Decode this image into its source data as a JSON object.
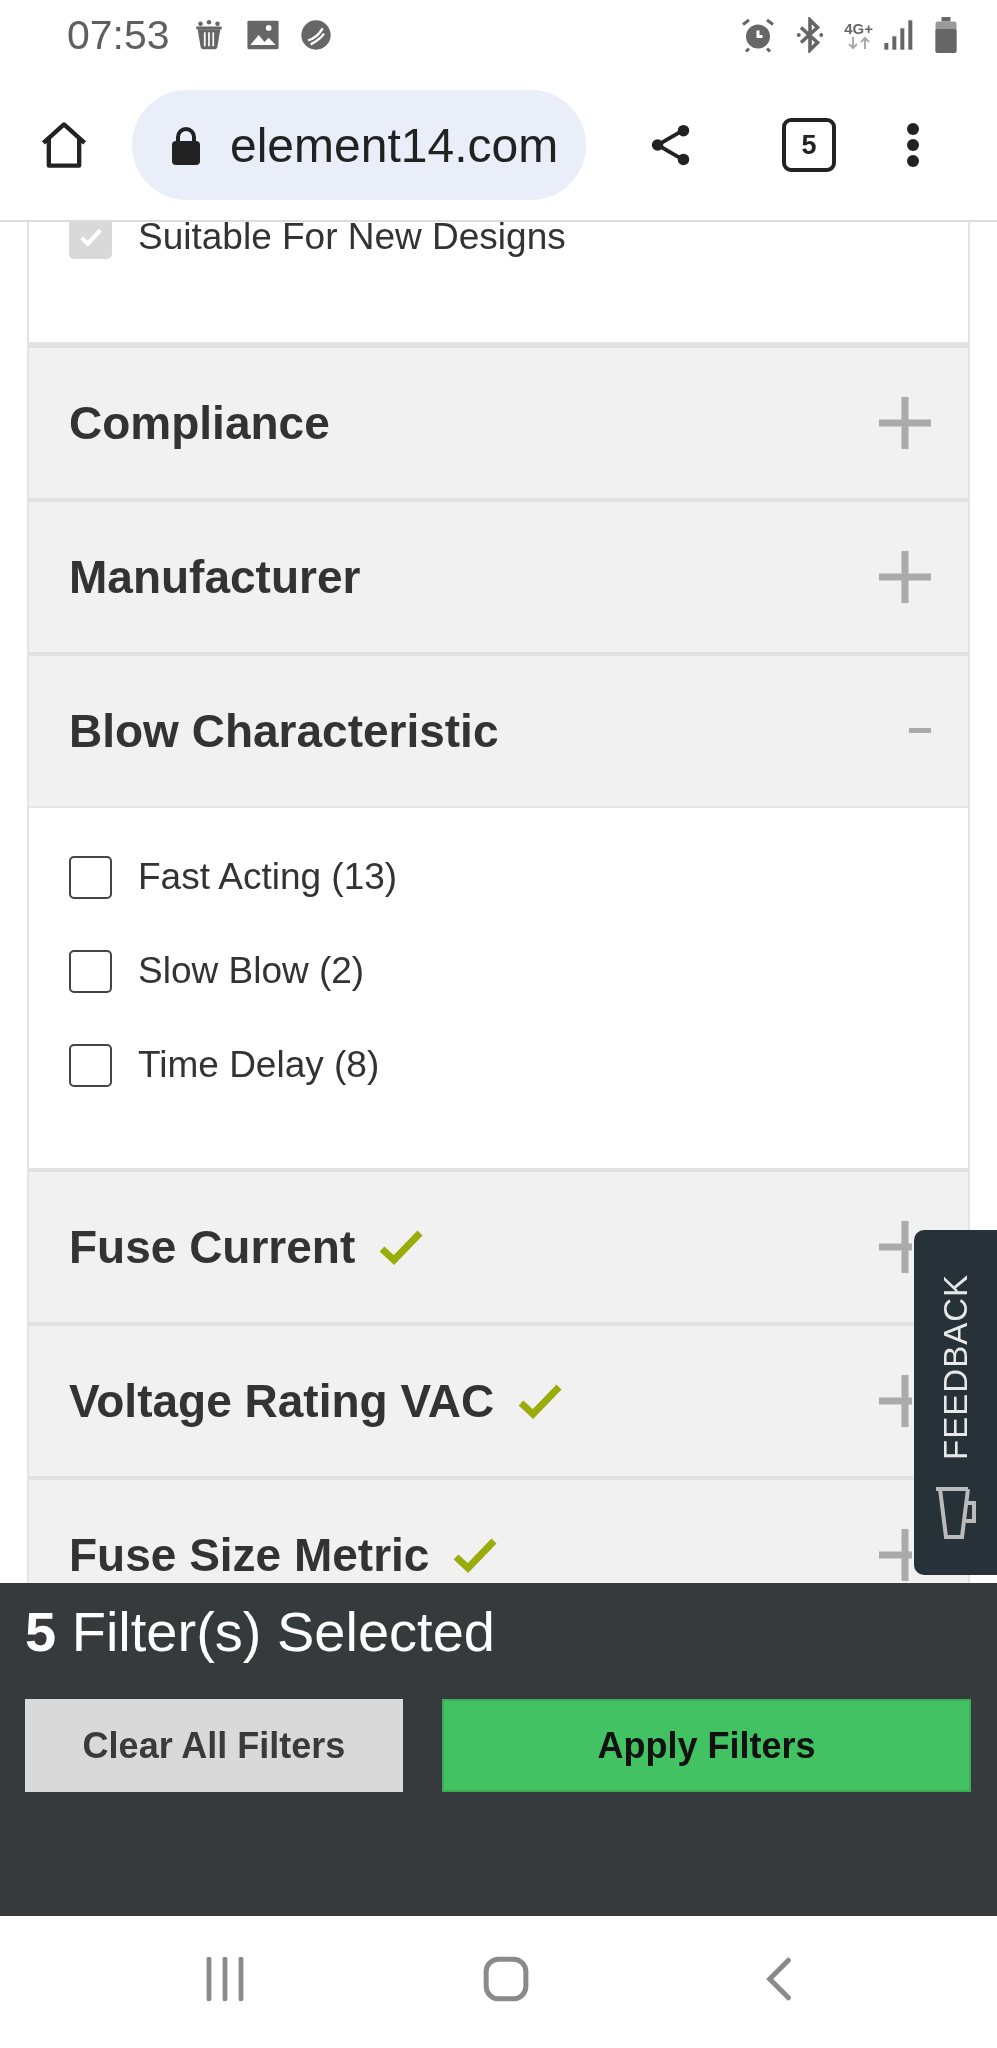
{
  "status_bar": {
    "time": "07:53",
    "network_label": "4G+"
  },
  "browser": {
    "url": "element14.com",
    "tab_count": "5"
  },
  "top_option": {
    "label": "Suitable For New Designs",
    "checked": true,
    "disabled": true
  },
  "sections": [
    {
      "title": "Compliance",
      "expanded": false,
      "filtered": false
    },
    {
      "title": "Manufacturer",
      "expanded": false,
      "filtered": false
    },
    {
      "title": "Blow Characteristic",
      "expanded": true,
      "filtered": false,
      "options": [
        {
          "label": "Fast Acting (13)",
          "checked": false
        },
        {
          "label": "Slow Blow (2)",
          "checked": false
        },
        {
          "label": "Time Delay (8)",
          "checked": false
        }
      ]
    },
    {
      "title": "Fuse Current",
      "expanded": false,
      "filtered": true
    },
    {
      "title": "Voltage Rating VAC",
      "expanded": false,
      "filtered": true
    },
    {
      "title": "Fuse Size Metric",
      "expanded": false,
      "filtered": true
    }
  ],
  "feedback_tab": {
    "label": "FEEDBACK"
  },
  "filter_bar": {
    "title": "**5** Filter(s) Selected",
    "buttons": [
      {
        "label": "Clear All Filters",
        "kind": "secondary"
      },
      {
        "label": "Apply Filters",
        "kind": "primary"
      }
    ]
  }
}
